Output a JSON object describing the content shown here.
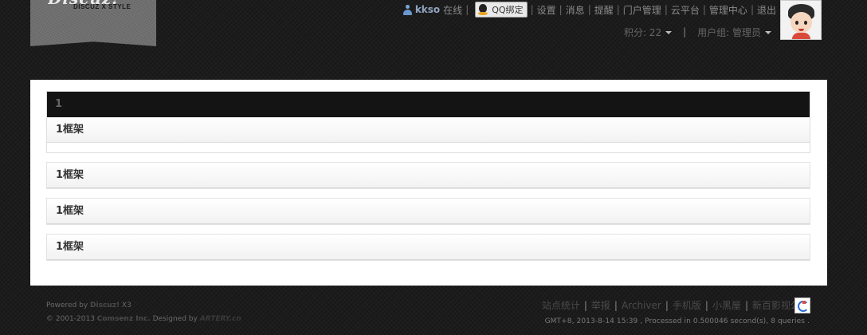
{
  "logo": {
    "subtitle": "DISCUZ X STYLE"
  },
  "topnav": {
    "username": "kkso",
    "status": "在线",
    "qq_label": "QQ绑定",
    "links": [
      "设置",
      "消息",
      "提醒",
      "门户管理",
      "云平台",
      "管理中心",
      "退出"
    ]
  },
  "subnav": {
    "credits": "积分: 22",
    "usergroup": "用户组: 管理员"
  },
  "main": {
    "frame1_title": "1",
    "frames": [
      "1框架",
      "1框架",
      "1框架",
      "1框架"
    ]
  },
  "footer": {
    "powered_prefix": "Powered by",
    "powered_brand": "Discuz!",
    "powered_version": "X3",
    "copyright_prefix": "© 2001-2013",
    "copyright_company": "Comsenz Inc.",
    "designed_prefix": "Designed by",
    "designed_brand": "ARTERY.cn",
    "links": [
      "站点统计",
      "举报",
      "Archiver",
      "手机版",
      "小黑屋",
      "新百影视公司"
    ],
    "stats": "GMT+8, 2013-8-14 15:39 , Processed in 0.500046 second(s), 8 queries ."
  },
  "colors": {
    "background": "#1c1c1c",
    "panel": "#ffffff",
    "dark_bar": "#141414"
  }
}
